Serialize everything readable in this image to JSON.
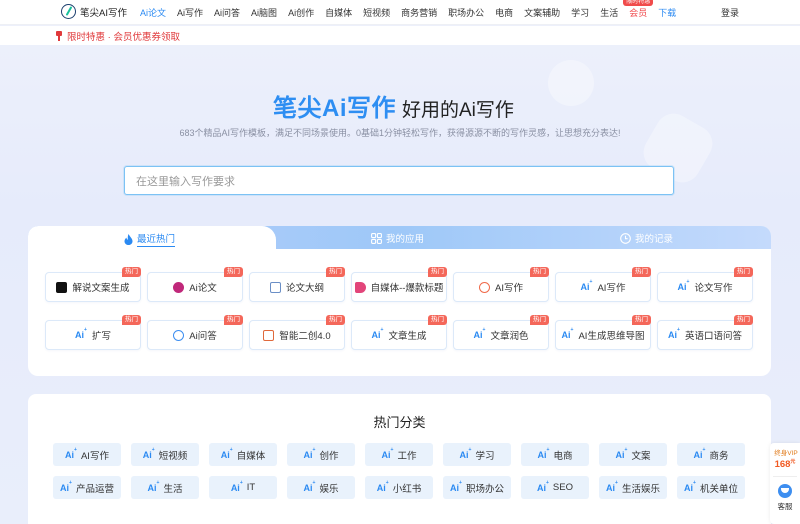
{
  "header": {
    "logo_text": "笔尖AI写作",
    "nav": [
      {
        "label": "Ai论文",
        "style": "active"
      },
      {
        "label": "Ai写作",
        "style": ""
      },
      {
        "label": "Ai问答",
        "style": ""
      },
      {
        "label": "Ai脑图",
        "style": ""
      },
      {
        "label": "Ai创作",
        "style": ""
      },
      {
        "label": "自媒体",
        "style": ""
      },
      {
        "label": "短视频",
        "style": ""
      },
      {
        "label": "商务营销",
        "style": ""
      },
      {
        "label": "职场办公",
        "style": ""
      },
      {
        "label": "电商",
        "style": ""
      },
      {
        "label": "文案辅助",
        "style": ""
      },
      {
        "label": "学习",
        "style": ""
      },
      {
        "label": "生活",
        "style": ""
      },
      {
        "label": "会员",
        "style": "red",
        "badge": "限时特惠"
      },
      {
        "label": "下载",
        "style": "blue"
      }
    ],
    "login_label": "登录"
  },
  "promo": {
    "text": "限时特惠 · 会员优惠券领取"
  },
  "hero": {
    "title_brand": "笔尖Ai写作",
    "title_rest": "好用的Ai写作",
    "subtitle": "683个精品AI写作模板，满足不同场景使用。0基础1分钟轻松写作，获得源源不断的写作灵感，让思想充分表达!",
    "search_placeholder": "在这里输入写作要求"
  },
  "tabs": [
    {
      "label": "最近热门",
      "icon": "flame-icon"
    },
    {
      "label": "我的应用",
      "icon": "grid-icon"
    },
    {
      "label": "我的记录",
      "icon": "clock-icon"
    }
  ],
  "hot_badge": "热门",
  "ai_glyph": "Ai",
  "tools": [
    {
      "label": "解说文案生成",
      "icon": "tiktok-icon",
      "hot": true
    },
    {
      "label": "Ai论文",
      "icon": "paper-icon",
      "hot": true
    },
    {
      "label": "论文大纲",
      "icon": "document-icon",
      "hot": true
    },
    {
      "label": "自媒体--爆款标题",
      "icon": "tag-icon",
      "hot": true
    },
    {
      "label": "AI写作",
      "icon": "ai-badge-icon",
      "hot": true
    },
    {
      "label": "AI写作",
      "icon": "ai-icon",
      "hot": true
    },
    {
      "label": "论文写作",
      "icon": "ai-icon",
      "hot": true
    },
    {
      "label": "扩写",
      "icon": "ai-icon",
      "hot": true
    },
    {
      "label": "Ai问答",
      "icon": "chat-icon",
      "hot": true
    },
    {
      "label": "智能二创4.0",
      "icon": "recreate-icon",
      "hot": true
    },
    {
      "label": "文章生成",
      "icon": "ai-icon",
      "hot": true
    },
    {
      "label": "文章润色",
      "icon": "ai-icon",
      "hot": true
    },
    {
      "label": "AI生成思维导图",
      "icon": "ai-icon",
      "hot": true
    },
    {
      "label": "英语口语问答",
      "icon": "ai-icon",
      "hot": true
    }
  ],
  "categories_title": "热门分类",
  "categories": [
    "AI写作",
    "短视频",
    "自媒体",
    "创作",
    "工作",
    "学习",
    "电商",
    "文案",
    "商务",
    "产品运营",
    "生活",
    "IT",
    "娱乐",
    "小红书",
    "职场办公",
    "SEO",
    "生活娱乐",
    "机关单位"
  ],
  "side": {
    "vip_label": "终身VIP",
    "price": "168",
    "price_unit": "元",
    "cs_label": "客服"
  },
  "colors": {
    "accent": "#2b8af2",
    "hot": "#f4675a",
    "promo": "#e0393b"
  }
}
